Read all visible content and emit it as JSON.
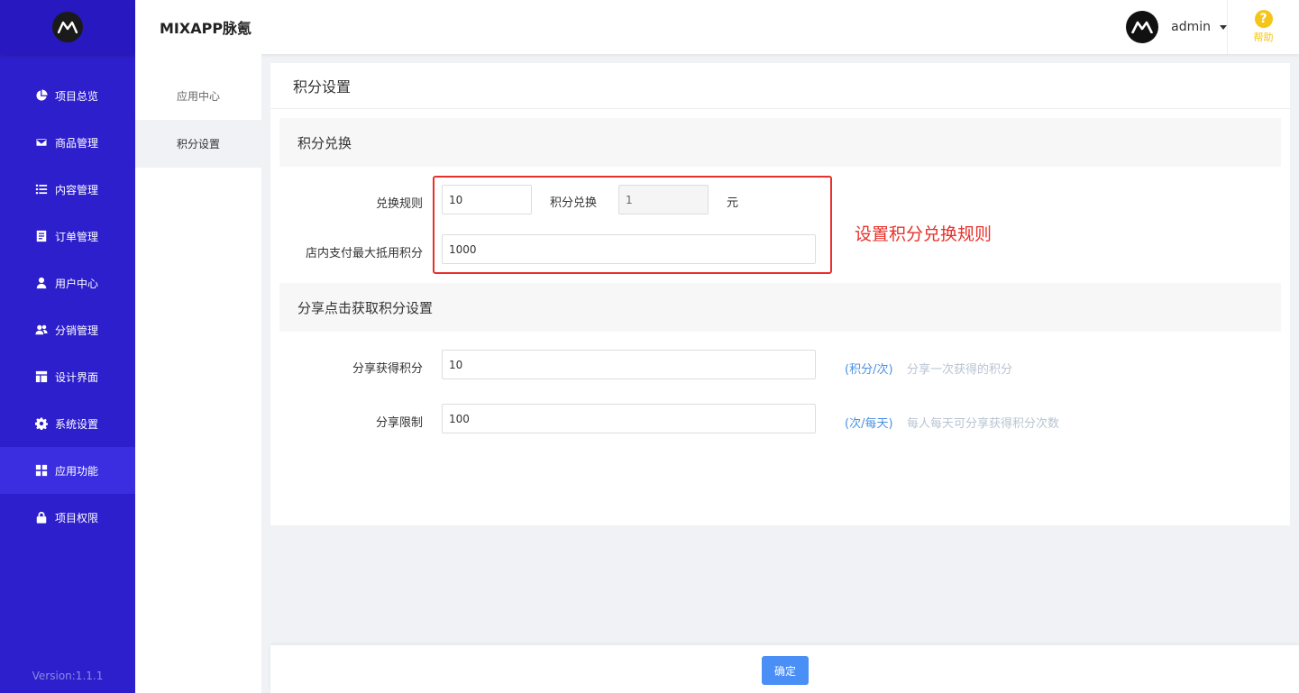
{
  "app": {
    "brand": "MIXAPP脉氪",
    "version": "Version:1.1.1"
  },
  "header": {
    "username": "admin",
    "help_label": "帮助",
    "help_glyph": "?"
  },
  "sidebar": {
    "items": [
      {
        "label": "项目总览",
        "icon": "pie-chart-icon"
      },
      {
        "label": "商品管理",
        "icon": "envelope-icon"
      },
      {
        "label": "内容管理",
        "icon": "list-icon"
      },
      {
        "label": "订单管理",
        "icon": "document-icon"
      },
      {
        "label": "用户中心",
        "icon": "user-icon"
      },
      {
        "label": "分销管理",
        "icon": "users-icon"
      },
      {
        "label": "设计界面",
        "icon": "layout-icon"
      },
      {
        "label": "系统设置",
        "icon": "gear-icon"
      },
      {
        "label": "应用功能",
        "icon": "grid-icon",
        "active": true
      },
      {
        "label": "项目权限",
        "icon": "lock-icon"
      }
    ]
  },
  "subnav": {
    "items": [
      {
        "label": "应用中心"
      },
      {
        "label": "积分设置",
        "active": true
      }
    ]
  },
  "main": {
    "title": "积分设置",
    "exchange_section": {
      "heading": "积分兑换",
      "rule_label": "兑换规则",
      "points_value": "10",
      "middle_text": "积分兑换",
      "yuan_value": "1",
      "unit_text": "元",
      "max_label": "店内支付最大抵用积分",
      "max_value": "1000"
    },
    "annotation": "设置积分兑换规则",
    "share_section": {
      "heading": "分享点击获取积分设置",
      "earn_label": "分享获得积分",
      "earn_value": "10",
      "earn_unit": "(积分/次)",
      "earn_desc": "分享一次获得的积分",
      "limit_label": "分享限制",
      "limit_value": "100",
      "limit_unit": "(次/每天)",
      "limit_desc": "每人每天可分享获得积分次数"
    }
  },
  "footer": {
    "confirm_label": "确定"
  },
  "colors": {
    "sidebar_bg": "#2d1fcb",
    "accent_blue": "#4a8ff5",
    "annotation_red": "#e8302a",
    "help_yellow": "#f5c518"
  }
}
